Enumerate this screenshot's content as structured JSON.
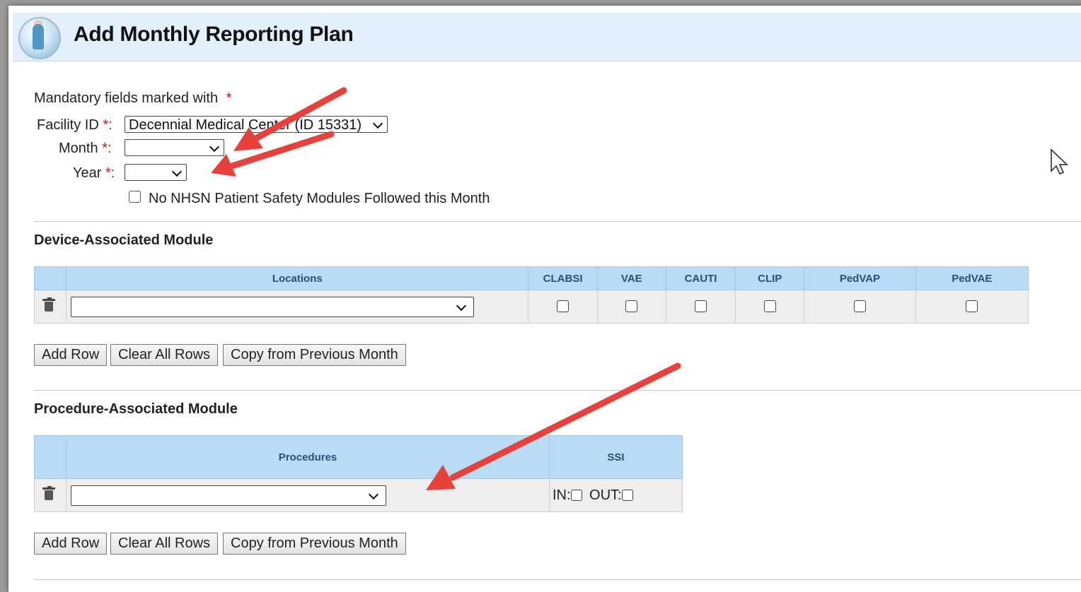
{
  "header": {
    "title": "Add Monthly Reporting Plan"
  },
  "form": {
    "mandatory_note": "Mandatory fields marked with",
    "required_marker": "*",
    "facility_label": "Facility ID",
    "facility_value": "Decennial Medical Center (ID 15331)",
    "month_label": "Month",
    "month_value": "",
    "year_label": "Year",
    "year_value": "",
    "colon_marker": "*:",
    "no_modules_label": "No NHSN Patient Safety Modules Followed this Month"
  },
  "device_module": {
    "title": "Device-Associated Module",
    "columns": [
      "Locations",
      "CLABSI",
      "VAE",
      "CAUTI",
      "CLIP",
      "PedVAP",
      "PedVAE"
    ],
    "buttons": {
      "add_row": "Add Row",
      "clear_all": "Clear All Rows",
      "copy_prev": "Copy from Previous Month"
    }
  },
  "procedure_module": {
    "title": "Procedure-Associated Module",
    "columns": [
      "Procedures",
      "SSI"
    ],
    "ssi_in": "IN:",
    "ssi_out": "OUT:",
    "buttons": {
      "add_row": "Add Row",
      "clear_all": "Clear All Rows",
      "copy_prev": "Copy from Previous Month"
    }
  },
  "colors": {
    "header_bg": "#e3f0fb",
    "table_header_bg": "#b8dcf6",
    "required": "#dd1111",
    "annotation_arrow": "#e8413c"
  }
}
